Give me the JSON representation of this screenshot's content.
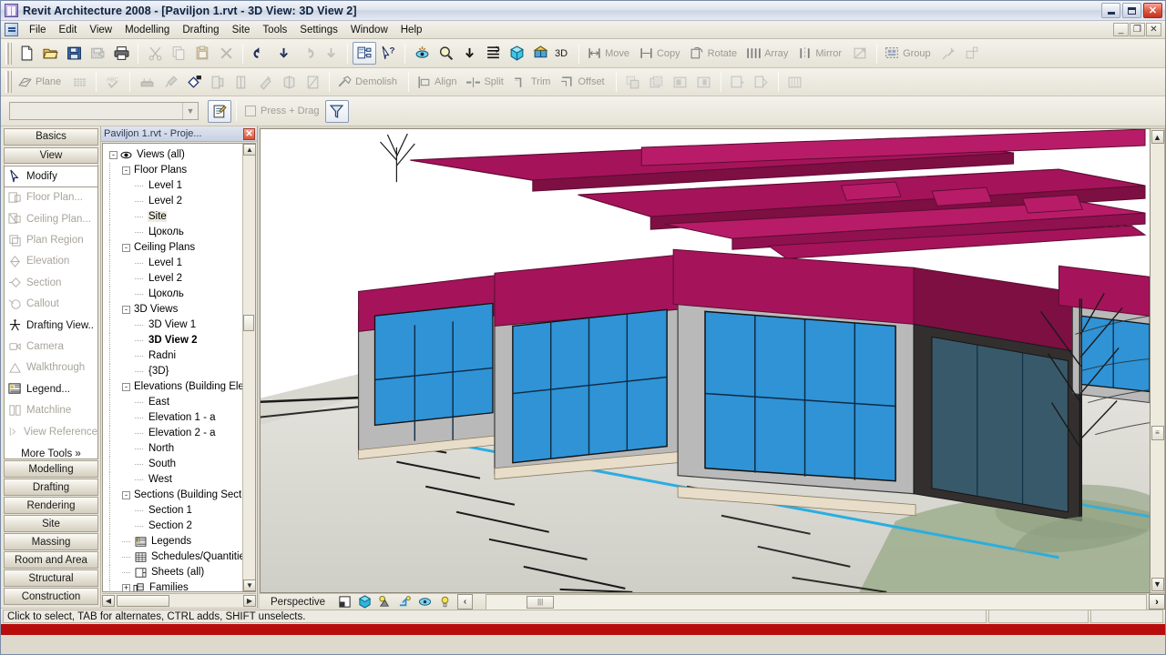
{
  "window": {
    "title": "Revit Architecture 2008 - [Paviljon 1.rvt - 3D View: 3D View 2]",
    "app_icon": "revit-app-icon",
    "minimize": "_",
    "maximize": "□",
    "close": "✕"
  },
  "menu": {
    "doc_icon": "document-icon",
    "items": [
      "File",
      "Edit",
      "View",
      "Modelling",
      "Drafting",
      "Site",
      "Tools",
      "Settings",
      "Window",
      "Help"
    ],
    "doc_buttons": [
      "_",
      "❐",
      "✕"
    ]
  },
  "toolbar1": {
    "file_group": [
      {
        "name": "new-icon",
        "label": "New"
      },
      {
        "name": "open-folder-icon",
        "label": "Open"
      },
      {
        "name": "save-icon",
        "label": "Save"
      },
      {
        "name": "save-as-icon",
        "label": "Save As",
        "disabled": true
      },
      {
        "name": "print-icon",
        "label": "Print"
      }
    ],
    "edit_group": [
      {
        "name": "cut-scissors-icon",
        "label": "Cut",
        "disabled": true
      },
      {
        "name": "copy-icon",
        "label": "Copy",
        "disabled": true
      },
      {
        "name": "paste-clipboard-icon",
        "label": "Paste",
        "disabled": true
      },
      {
        "name": "delete-x-icon",
        "label": "Delete",
        "disabled": true
      }
    ],
    "undo_group": [
      {
        "name": "undo-arrow-icon",
        "label": "Undo"
      },
      {
        "name": "undo-dropdown-icon",
        "label": "Undo List"
      },
      {
        "name": "redo-arrow-icon",
        "label": "Redo",
        "disabled": true
      },
      {
        "name": "redo-dropdown-icon",
        "label": "Redo List",
        "disabled": true
      }
    ],
    "design_group": [
      {
        "name": "design-bar-icon",
        "label": "Design Bar",
        "framed": true
      },
      {
        "name": "help-pointer-icon",
        "label": "Context Help"
      }
    ],
    "view_group": [
      {
        "name": "dynamic-view-icon",
        "label": "Dynamically Modify View"
      },
      {
        "name": "zoom-magnifier-icon",
        "label": "Zoom"
      },
      {
        "name": "zoom-dropdown-icon",
        "label": "Zoom Options"
      },
      {
        "name": "thin-lines-icon",
        "label": "Thin Lines"
      },
      {
        "name": "shadows-box-icon",
        "label": "Shading"
      },
      {
        "name": "default-3d-view-icon",
        "label": "Default 3D View"
      }
    ],
    "view_group_text": "3D",
    "edit_tools": [
      {
        "name": "move-icon",
        "label": "Move"
      },
      {
        "name": "copy-tool-icon",
        "label": "Copy"
      },
      {
        "name": "rotate-icon",
        "label": "Rotate"
      },
      {
        "name": "array-icon",
        "label": "Array"
      },
      {
        "name": "mirror-icon",
        "label": "Mirror"
      },
      {
        "name": "resize-icon",
        "label": ""
      },
      {
        "name": "group-icon",
        "label": "Group"
      },
      {
        "name": "pin-icon",
        "label": ""
      },
      {
        "name": "unpin-icon",
        "label": ""
      }
    ]
  },
  "toolbar2": {
    "group_a": [
      {
        "name": "work-plane-icon",
        "label": "Plane"
      },
      {
        "name": "plane-grid-icon",
        "label": ""
      }
    ],
    "group_b": [
      {
        "name": "spelling-check-icon",
        "label": ""
      }
    ],
    "group_c": [
      {
        "name": "material-icon",
        "label": ""
      },
      {
        "name": "eyedropper-icon",
        "label": ""
      },
      {
        "name": "paint-can-icon",
        "label": ""
      },
      {
        "name": "linework-icon",
        "label": ""
      },
      {
        "name": "split-face-icon",
        "label": ""
      },
      {
        "name": "paint-brush-icon",
        "label": ""
      },
      {
        "name": "model-render-icon",
        "label": ""
      },
      {
        "name": "phase-icon",
        "label": ""
      }
    ],
    "group_d": [
      {
        "name": "demolish-hammer-icon",
        "label": "Demolish"
      }
    ],
    "group_e": [
      {
        "name": "align-icon",
        "label": "Align"
      },
      {
        "name": "split-icon",
        "label": "Split"
      },
      {
        "name": "trim-icon",
        "label": "Trim"
      },
      {
        "name": "offset-icon",
        "label": "Offset"
      }
    ],
    "group_f": [
      {
        "name": "copy-stack-icon",
        "label": ""
      },
      {
        "name": "paste-stack-icon",
        "label": ""
      },
      {
        "name": "cut-region-icon",
        "label": ""
      },
      {
        "name": "join-region-icon",
        "label": ""
      }
    ],
    "group_g": [
      {
        "name": "split-wall-icon",
        "label": ""
      },
      {
        "name": "wall-join-icon",
        "label": ""
      }
    ],
    "group_h": [
      {
        "name": "beam-system-icon",
        "label": ""
      }
    ]
  },
  "toolbar3": {
    "type_selector_value": "",
    "type_selector_placeholder": "",
    "properties_button": "element-properties-icon",
    "press_drag_label": "Press + Drag",
    "press_drag_checked": false,
    "filter_button": "filter-funnel-icon"
  },
  "design_bar": {
    "top_tabs": [
      "Basics",
      "View"
    ],
    "items": [
      {
        "label": "Modify",
        "icon": "arrow-cursor-icon",
        "state": "selected"
      },
      {
        "label": "Floor Plan...",
        "icon": "floor-plan-icon",
        "state": "disabled"
      },
      {
        "label": "Ceiling Plan...",
        "icon": "ceiling-plan-icon",
        "state": "disabled"
      },
      {
        "label": "Plan Region",
        "icon": "plan-region-icon",
        "state": "disabled"
      },
      {
        "label": "Elevation",
        "icon": "elevation-icon",
        "state": "disabled"
      },
      {
        "label": "Section",
        "icon": "section-icon",
        "state": "disabled"
      },
      {
        "label": "Callout",
        "icon": "callout-icon",
        "state": "disabled"
      },
      {
        "label": "Drafting View..",
        "icon": "drafting-view-icon",
        "state": "active"
      },
      {
        "label": "Camera",
        "icon": "camera-icon",
        "state": "disabled"
      },
      {
        "label": "Walkthrough",
        "icon": "walkthrough-icon",
        "state": "disabled"
      },
      {
        "label": "Legend...",
        "icon": "legend-icon",
        "state": "active"
      },
      {
        "label": "Matchline",
        "icon": "matchline-icon",
        "state": "disabled"
      },
      {
        "label": "View Reference",
        "icon": "view-reference-icon",
        "state": "disabled"
      }
    ],
    "more_tools": "More Tools »",
    "bottom_tabs": [
      "Modelling",
      "Drafting",
      "Rendering",
      "Site",
      "Massing",
      "Room and Area",
      "Structural",
      "Construction"
    ]
  },
  "project_browser": {
    "title": "Paviljon 1.rvt - Proje...",
    "close_icon": "close-icon",
    "nodes": [
      {
        "label": "Views (all)",
        "depth": 0,
        "toggle": "-",
        "icon": "views-eye-icon"
      },
      {
        "label": "Floor Plans",
        "depth": 1,
        "toggle": "-"
      },
      {
        "label": "Level 1",
        "depth": 2
      },
      {
        "label": "Level 2",
        "depth": 2
      },
      {
        "label": "Site",
        "depth": 2,
        "highlight": true
      },
      {
        "label": "Цоколь",
        "depth": 2
      },
      {
        "label": "Ceiling Plans",
        "depth": 1,
        "toggle": "-"
      },
      {
        "label": "Level 1",
        "depth": 2
      },
      {
        "label": "Level 2",
        "depth": 2
      },
      {
        "label": "Цоколь",
        "depth": 2
      },
      {
        "label": "3D Views",
        "depth": 1,
        "toggle": "-"
      },
      {
        "label": "3D View 1",
        "depth": 2
      },
      {
        "label": "3D View 2",
        "depth": 2,
        "bold": true
      },
      {
        "label": "Radni",
        "depth": 2
      },
      {
        "label": "{3D}",
        "depth": 2
      },
      {
        "label": "Elevations (Building Elevation)",
        "depth": 1,
        "toggle": "-"
      },
      {
        "label": "East",
        "depth": 2
      },
      {
        "label": "Elevation 1 - a",
        "depth": 2
      },
      {
        "label": "Elevation 2 - a",
        "depth": 2
      },
      {
        "label": "North",
        "depth": 2
      },
      {
        "label": "South",
        "depth": 2
      },
      {
        "label": "West",
        "depth": 2
      },
      {
        "label": "Sections (Building Section)",
        "depth": 1,
        "toggle": "-"
      },
      {
        "label": "Section 1",
        "depth": 2
      },
      {
        "label": "Section 2",
        "depth": 2
      },
      {
        "label": "Legends",
        "depth": 1,
        "icon": "legend-icon"
      },
      {
        "label": "Schedules/Quantities",
        "depth": 1,
        "icon": "schedule-table-icon"
      },
      {
        "label": "Sheets (all)",
        "depth": 1,
        "icon": "sheet-icon"
      },
      {
        "label": "Families",
        "depth": 1,
        "toggle": "+",
        "icon": "families-icon"
      }
    ]
  },
  "view_control_bar": {
    "scale_label": "Perspective",
    "buttons": [
      {
        "name": "detail-level-icon",
        "label": "Detail Level"
      },
      {
        "name": "model-graphics-style-icon",
        "label": "Model Graphics Style"
      },
      {
        "name": "shadows-off-icon",
        "label": "Shadows"
      },
      {
        "name": "render-settings-icon",
        "label": "Render Settings"
      },
      {
        "name": "crop-region-icon",
        "label": "Crop Region"
      },
      {
        "name": "sun-path-icon",
        "label": "Sun Path"
      }
    ],
    "back_button": "‹",
    "forward_button": "›"
  },
  "status_bar": {
    "message": "Click to select, TAB for alternates, CTRL adds, SHIFT unselects."
  },
  "model": {
    "description": "3D perspective view of a single-storey pavilion building with magenta cantilevered flat roof slabs, grey and dark-grey wall panels, large blue curtain-wall glazing, concrete forecourt with parking stall stripes and a blue kerb line, green landscaped areas and bare trees.",
    "colors": {
      "roof_magenta": "#a5145a",
      "roof_magenta_dark": "#7d0f43",
      "roof_magenta_light": "#b81c68",
      "wall_grey": "#b9b9b9",
      "wall_dark": "#3d3b3b",
      "glass_blue": "#2f93d6",
      "glass_blue_dark": "#1f6a9e",
      "glass_teal": "#3f6c80",
      "ground_pavement": "#d2d2cc",
      "ground_light": "#e4e3dd",
      "grass_green": "#9aab8a",
      "kerb_blue": "#2aaee0",
      "sky": "#ffffff"
    }
  }
}
